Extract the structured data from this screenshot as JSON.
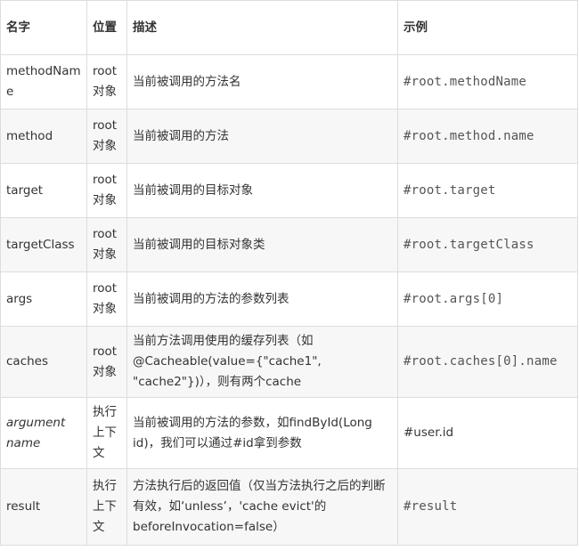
{
  "table": {
    "headers": [
      "名字",
      "位置",
      "描述",
      "示例"
    ],
    "rows": [
      {
        "name": "methodName",
        "position": "root对象",
        "description": "当前被调用的方法名",
        "example": "#root.methodName"
      },
      {
        "name": "method",
        "position": "root对象",
        "description": "当前被调用的方法",
        "example": "#root.method.name"
      },
      {
        "name": "target",
        "position": "root对象",
        "description": "当前被调用的目标对象",
        "example": "#root.target"
      },
      {
        "name": "targetClass",
        "position": "root对象",
        "description": "当前被调用的目标对象类",
        "example": "#root.targetClass"
      },
      {
        "name": "args",
        "position": "root对象",
        "description": "当前被调用的方法的参数列表",
        "example": "#root.args[0]"
      },
      {
        "name": "caches",
        "position": "root对象",
        "description": "当前方法调用使用的缓存列表（如@Cacheable(value={\"cache1\", \"cache2\"})），则有两个cache",
        "example": "#root.caches[0].name"
      },
      {
        "name": "argument name",
        "position": "执行上下文",
        "description": "当前被调用的方法的参数，如findById(Long id)，我们可以通过#id拿到参数",
        "example": "#user.id"
      },
      {
        "name": "result",
        "position": "执行上下文",
        "description": "方法执行后的返回值（仅当方法执行之后的判断有效，如‘unless’，'cache evict'的beforeInvocation=false）",
        "example": "#result"
      }
    ]
  }
}
